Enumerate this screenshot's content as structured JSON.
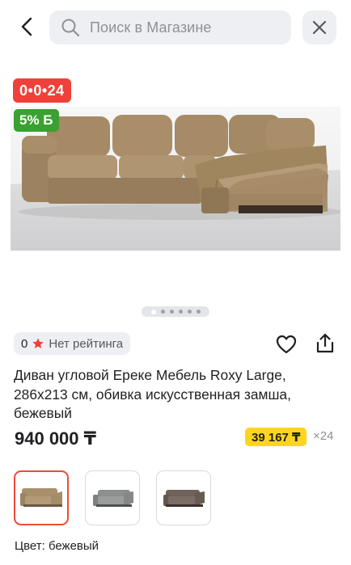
{
  "header": {
    "search_placeholder": "Поиск в Магазине"
  },
  "gallery": {
    "deal_badge": "0•0•24",
    "bonus_badge": "5% Б",
    "dots_count": 6,
    "active_dot": 1
  },
  "rating": {
    "count": "0",
    "label": "Нет рейтинга"
  },
  "product": {
    "title": "Диван угловой Ереке Мебель Roxy Large, 286x213 см, обивка искусственная замша, бежевый",
    "price": "940 000 ₸",
    "installment_amount": "39 167 ₸",
    "installment_months": "×24"
  },
  "variants": [
    {
      "name": "бежевый",
      "color": "#a8906d",
      "selected": true
    },
    {
      "name": "серый",
      "color": "#8c8f8d",
      "selected": false
    },
    {
      "name": "коричневый",
      "color": "#6f625a",
      "selected": false
    }
  ],
  "color_label": "Цвет: бежевый",
  "colors": {
    "accent_red": "#f0403a",
    "bonus_green": "#3aa130",
    "installment_yellow": "#ffd51c",
    "selected_border": "#ef4a37"
  }
}
